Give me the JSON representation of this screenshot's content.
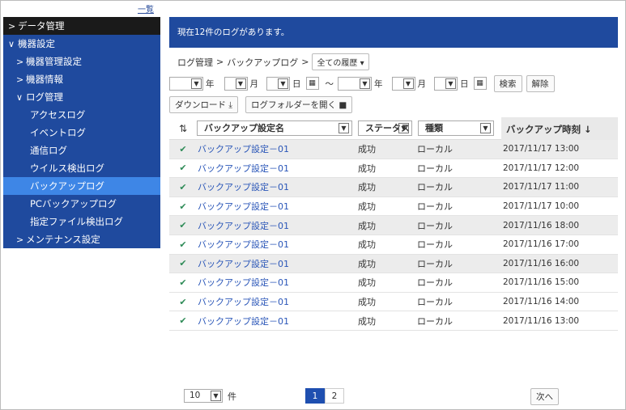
{
  "top_link": "一覧",
  "sidebar": {
    "data_mgmt": "データ管理",
    "device_settings": "機器設定",
    "device_mgmt_settings": "機器管理設定",
    "device_info": "機器情報",
    "log_mgmt": "ログ管理",
    "logs": [
      "アクセスログ",
      "イベントログ",
      "通信ログ",
      "ウイルス検出ログ",
      "バックアップログ",
      "PCバックアップログ",
      "指定ファイル検出ログ"
    ],
    "maintenance": "メンテナンス設定"
  },
  "banner": "現在12件のログがあります。",
  "breadcrumb": {
    "part1": "ログ管理",
    "sep": ">",
    "part2": "バックアップログ",
    "filter": "全ての履歴"
  },
  "filter": {
    "year": "年",
    "month": "月",
    "day": "日",
    "tilde": "～",
    "search": "検索",
    "clear": "解除"
  },
  "tools": {
    "download": "ダウンロード",
    "open_folder": "ログフォルダーを開く"
  },
  "table": {
    "headers": {
      "name": "バックアップ設定名",
      "status": "ステータス",
      "kind": "種類",
      "time": "バックアップ時刻 ↓"
    },
    "rows": [
      {
        "name": "バックアップ設定－01",
        "status": "成功",
        "kind": "ローカル",
        "time": "2017/11/17 13:00"
      },
      {
        "name": "バックアップ設定－01",
        "status": "成功",
        "kind": "ローカル",
        "time": "2017/11/17 12:00"
      },
      {
        "name": "バックアップ設定－01",
        "status": "成功",
        "kind": "ローカル",
        "time": "2017/11/17 11:00"
      },
      {
        "name": "バックアップ設定－01",
        "status": "成功",
        "kind": "ローカル",
        "time": "2017/11/17 10:00"
      },
      {
        "name": "バックアップ設定－01",
        "status": "成功",
        "kind": "ローカル",
        "time": "2017/11/16 18:00"
      },
      {
        "name": "バックアップ設定－01",
        "status": "成功",
        "kind": "ローカル",
        "time": "2017/11/16 17:00"
      },
      {
        "name": "バックアップ設定－01",
        "status": "成功",
        "kind": "ローカル",
        "time": "2017/11/16 16:00"
      },
      {
        "name": "バックアップ設定－01",
        "status": "成功",
        "kind": "ローカル",
        "time": "2017/11/16 15:00"
      },
      {
        "name": "バックアップ設定－01",
        "status": "成功",
        "kind": "ローカル",
        "time": "2017/11/16 14:00"
      },
      {
        "name": "バックアップ設定－01",
        "status": "成功",
        "kind": "ローカル",
        "time": "2017/11/16 13:00"
      }
    ]
  },
  "footer": {
    "page_size": "10",
    "unit": "件",
    "pages": [
      "1",
      "2"
    ],
    "next": "次へ"
  }
}
